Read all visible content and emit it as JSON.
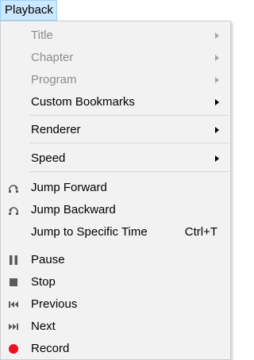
{
  "menubar": {
    "playback_label": "Playback"
  },
  "menu": {
    "title": "Title",
    "chapter": "Chapter",
    "program": "Program",
    "custom_bookmarks": "Custom Bookmarks",
    "renderer": "Renderer",
    "speed": "Speed",
    "jump_forward": "Jump Forward",
    "jump_backward": "Jump Backward",
    "jump_to_time": "Jump to Specific Time",
    "jump_to_time_shortcut": "Ctrl+T",
    "pause": "Pause",
    "stop": "Stop",
    "previous": "Previous",
    "next": "Next",
    "record": "Record"
  },
  "icons": {
    "jump_forward": "jump-forward-icon",
    "jump_backward": "jump-backward-icon",
    "pause": "pause-icon",
    "stop": "stop-icon",
    "previous": "previous-icon",
    "next": "next-icon",
    "record": "record-icon"
  },
  "colors": {
    "menubar_highlight": "#cce8ff",
    "menu_background": "#f2f2f2",
    "disabled_text": "#8c8c8c",
    "icon_gray": "#5a5a5a",
    "record_red": "#e81123"
  }
}
